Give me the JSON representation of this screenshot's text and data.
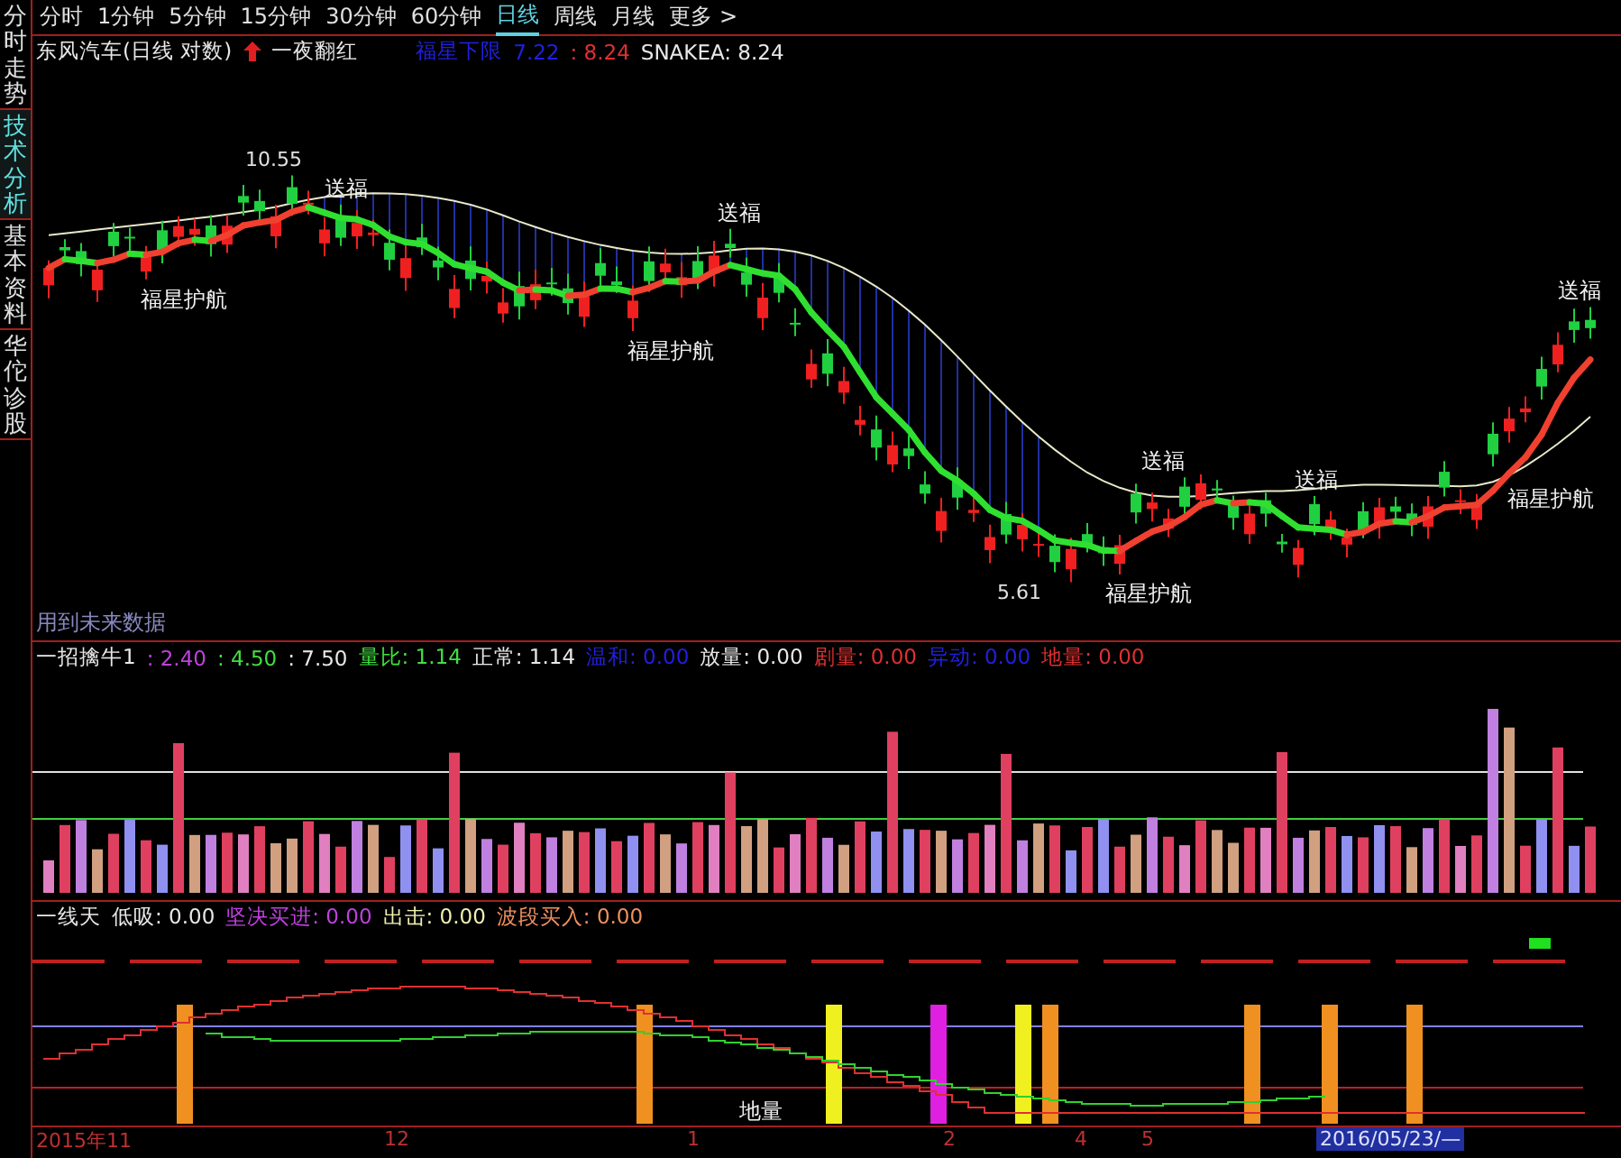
{
  "sidebar": {
    "tabs": [
      {
        "label": "分时走势",
        "selected": false
      },
      {
        "label": "技术分析",
        "selected": true
      },
      {
        "label": "基本资料",
        "selected": false
      },
      {
        "label": "华佗诊股",
        "selected": false
      }
    ]
  },
  "period_tabs": [
    {
      "label": "分时",
      "selected": false
    },
    {
      "label": "1分钟",
      "selected": false
    },
    {
      "label": "5分钟",
      "selected": false
    },
    {
      "label": "15分钟",
      "selected": false
    },
    {
      "label": "30分钟",
      "selected": false
    },
    {
      "label": "60分钟",
      "selected": false
    },
    {
      "label": "日线",
      "selected": true
    },
    {
      "label": "周线",
      "selected": false
    },
    {
      "label": "月线",
      "selected": false
    },
    {
      "label": "更多 >",
      "selected": false
    }
  ],
  "main_chart": {
    "title": "东风汽车(日线 对数)",
    "signal": "一夜翻红",
    "legend": [
      {
        "text": "福星下限",
        "color": "#2020e0"
      },
      {
        "text": "7.22",
        "color": "#2020e0"
      },
      {
        "text": ": 8.24",
        "color": "#e03030"
      },
      {
        "text": "SNAKEA: 8.24",
        "color": "#e8e8e8"
      }
    ],
    "annotations": [
      {
        "text": "10.55",
        "kind": "price"
      },
      {
        "text": "5.61",
        "kind": "price"
      },
      {
        "text": "送福",
        "kind": "tag"
      },
      {
        "text": "送福",
        "kind": "tag"
      },
      {
        "text": "送福",
        "kind": "tag"
      },
      {
        "text": "送福",
        "kind": "tag"
      },
      {
        "text": "送福",
        "kind": "tag"
      },
      {
        "text": "福星护航",
        "kind": "tag"
      },
      {
        "text": "福星护航",
        "kind": "tag"
      },
      {
        "text": "福星护航",
        "kind": "tag"
      },
      {
        "text": "福星护航",
        "kind": "tag"
      }
    ],
    "note": "用到未来数据"
  },
  "volume_panel": {
    "legend": [
      {
        "text": "一招擒牛1",
        "color": "#e8e8e8"
      },
      {
        "text": ": 2.40",
        "color": "#c040e0"
      },
      {
        "text": ": 4.50",
        "color": "#40e040"
      },
      {
        "text": ": 7.50",
        "color": "#e8e8e8"
      },
      {
        "text": "量比: 1.14",
        "color": "#40e040"
      },
      {
        "text": "正常: 1.14",
        "color": "#e8e8e8"
      },
      {
        "text": "温和: 0.00",
        "color": "#2020e0"
      },
      {
        "text": "放量: 0.00",
        "color": "#e8e8e8"
      },
      {
        "text": "剧量: 0.00",
        "color": "#e03030"
      },
      {
        "text": "异动: 0.00",
        "color": "#2020e0"
      },
      {
        "text": "地量: 0.00",
        "color": "#e03030"
      }
    ]
  },
  "signal_panel": {
    "legend": [
      {
        "text": "一线天",
        "color": "#e8e8e8"
      },
      {
        "text": "低吸: 0.00",
        "color": "#e8e8e8"
      },
      {
        "text": "坚决买进: 0.00",
        "color": "#c040e0"
      },
      {
        "text": "出击: 0.00",
        "color": "#f0f0b0"
      },
      {
        "text": "波段买入: 0.00",
        "color": "#f09060"
      }
    ],
    "marker": "地量"
  },
  "time_axis": [
    {
      "label": "2015年11",
      "kind": "tick"
    },
    {
      "label": "12",
      "kind": "tick"
    },
    {
      "label": "1",
      "kind": "tick"
    },
    {
      "label": "2",
      "kind": "tick"
    },
    {
      "label": "4",
      "kind": "tick"
    },
    {
      "label": "5",
      "kind": "tick"
    },
    {
      "label": "2016/05/23/—",
      "kind": "cursor"
    }
  ]
}
